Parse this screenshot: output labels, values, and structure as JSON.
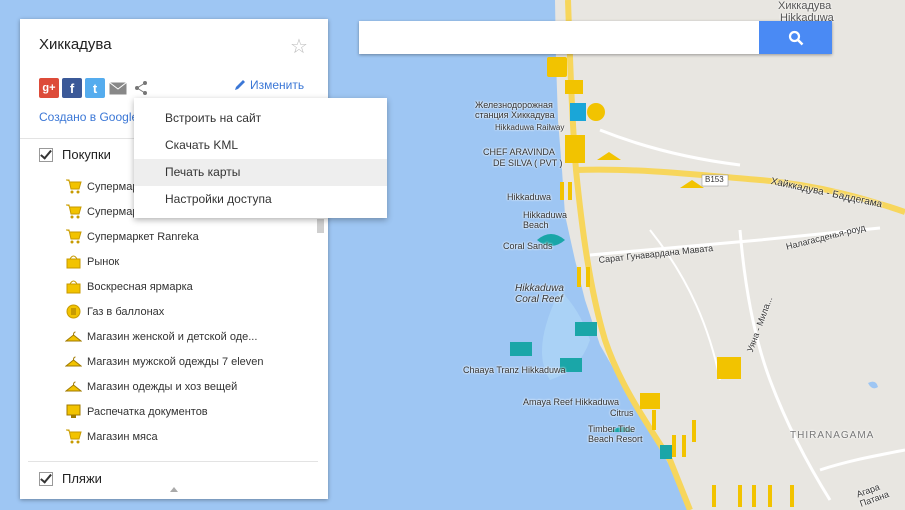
{
  "map": {
    "labels": {
      "town": "Хиккадува",
      "town_latin": "Hikkaduwa",
      "station": "Железнодорожная станция Хиккадува",
      "station_latin": "Hikkaduwa Railway",
      "chef": "CHEF ARAVINDA",
      "chef2": "DE SILVA ( PVT )",
      "hikkaduwa": "Hikkaduwa",
      "beach": "Hikkaduwa Beach",
      "coral_sands": "Coral Sands",
      "coral_reef": "Hikkaduwa Coral Reef",
      "chaaya": "Chaaya Tranz Hikkaduwa",
      "amaya": "Amaya Reef Hikkaduwa",
      "citrus": "Citrus",
      "timber": "Timber Tide Beach Resort",
      "road_b153": "B153",
      "road_main": "Хайккадува - Баддегама",
      "road_sarat": "Сарат Гунавардана Мавата",
      "road_nala": "Налагасденья-роуд",
      "road_uyana": "Уяна - Мила...",
      "thiranagama": "THIRANAGAMA",
      "patana": "Агара Патана"
    }
  },
  "search": {
    "placeholder": "",
    "button_icon": "search-icon"
  },
  "panel": {
    "title": "Хиккадува",
    "edit_label": "Изменить",
    "created_label": "Создано в Google",
    "share_icons": [
      "google-plus-icon",
      "facebook-icon",
      "twitter-icon",
      "mail-icon",
      "share-icon"
    ],
    "layers": [
      {
        "name": "Покупки",
        "checked": true,
        "items": [
          {
            "label": "Супермаркет",
            "icon": "cart-icon"
          },
          {
            "label": "Супермаркет",
            "icon": "cart-icon"
          },
          {
            "label": "Супермаркет Ranreka",
            "icon": "cart-icon"
          },
          {
            "label": "Рынок",
            "icon": "bag-icon"
          },
          {
            "label": "Воскресная ярмарка",
            "icon": "bag-icon"
          },
          {
            "label": "Газ в баллонах",
            "icon": "gas-hand-icon"
          },
          {
            "label": "Магазин женской и детской оде...",
            "icon": "hanger-icon"
          },
          {
            "label": "Магазин мужской одежды 7 eleven",
            "icon": "hanger-icon"
          },
          {
            "label": "Магазин одежды и хоз вещей",
            "icon": "hanger-icon"
          },
          {
            "label": "Распечатка документов",
            "icon": "monitor-icon"
          },
          {
            "label": "Магазин мяса",
            "icon": "cart-icon"
          }
        ]
      },
      {
        "name": "Пляжи",
        "checked": true
      }
    ]
  },
  "menu": {
    "items": [
      "Встроить на сайт",
      "Скачать KML",
      "Печать карты",
      "Настройки доступа"
    ],
    "hovered_index": 2
  },
  "colors": {
    "water": "#9ec6f3",
    "land": "#e8e6e1",
    "road": "#f7d65c",
    "accent": "#3b77d6",
    "search_button": "#4a8af4",
    "marker_yellow": "#f2c300"
  }
}
